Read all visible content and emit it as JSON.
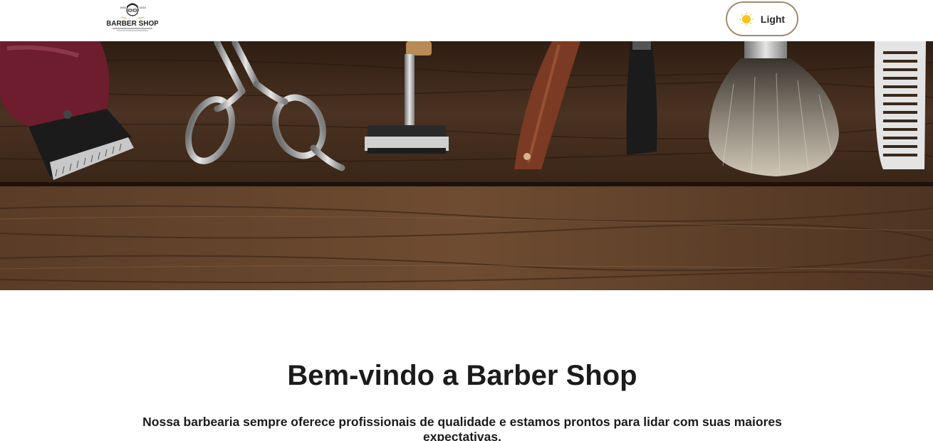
{
  "header": {
    "logo": {
      "text": "BARBER SHOP",
      "year_left": "1962",
      "year_right": "2016",
      "icon": "barber-logo-icon"
    },
    "theme_toggle": {
      "label": "Light",
      "icon": "sun-icon",
      "border_color": "#a58a6d",
      "sun_color": "#f5c518"
    }
  },
  "hero": {
    "image": "barber-tools-on-wood",
    "icons": [
      "hair-clipper-icon",
      "scissors-icon",
      "safety-razor-icon",
      "straight-razor-icon",
      "shaving-brush-icon",
      "comb-icon"
    ]
  },
  "welcome": {
    "title": "Bem-vindo a Barber Shop",
    "text": "Nossa barbearia sempre oferece profissionais de qualidade e estamos prontos para lidar com suas maiores expectativas."
  },
  "colors": {
    "accent": "#a58a6d",
    "text": "#1b1b1b",
    "wood_dark": "#3b2617",
    "wood_mid": "#6b4a30"
  }
}
